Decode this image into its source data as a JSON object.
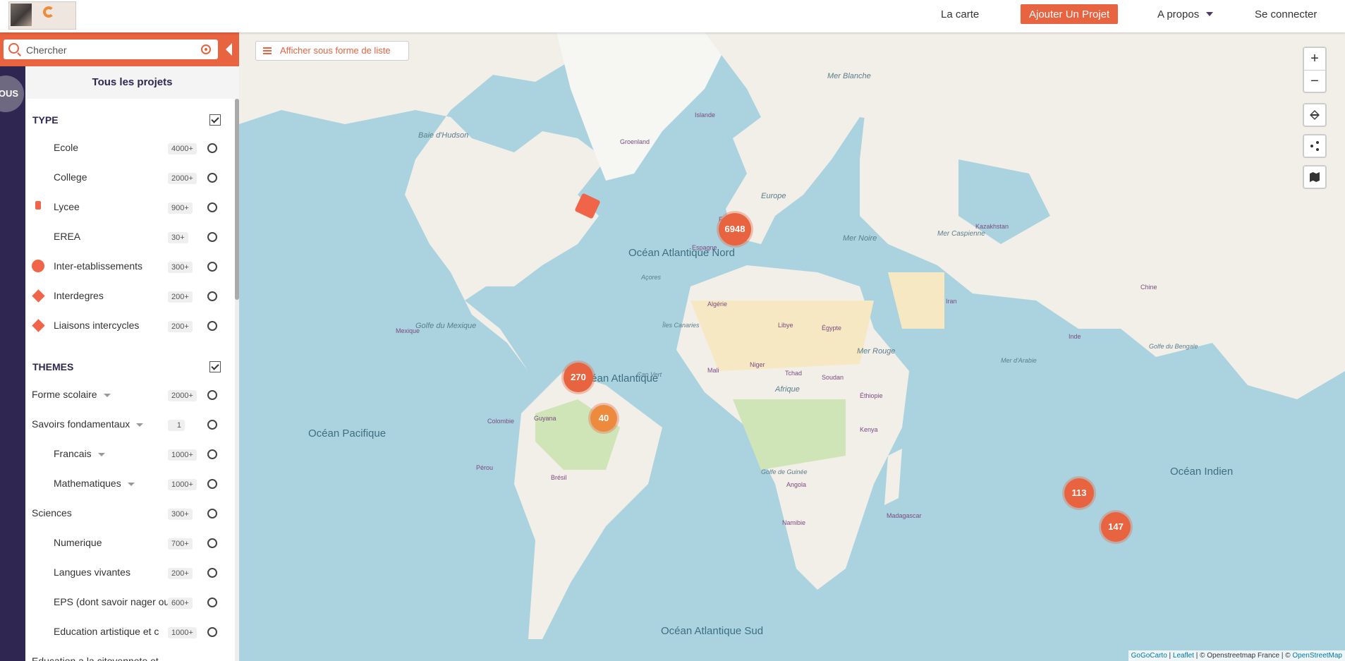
{
  "header": {
    "nav_carte": "La carte",
    "nav_add_project": "Ajouter Un Projet",
    "nav_about": "A propos",
    "nav_login": "Se connecter"
  },
  "sidebar": {
    "tous_label": "OUS",
    "search_placeholder": "Chercher",
    "panel_title": "Tous les projets",
    "type_section": "TYPE",
    "themes_section": "THEMES",
    "type_items": [
      {
        "label": "Ecole",
        "count": "4000+",
        "color": "#f0654a",
        "icon": "pin-icon"
      },
      {
        "label": "College",
        "count": "2000+",
        "color": "#f0654a",
        "icon": "pin-small-icon"
      },
      {
        "label": "Lycee",
        "count": "900+",
        "color": "#f0654a",
        "icon": "pushpin-icon"
      },
      {
        "label": "EREA",
        "count": "30+",
        "color": "#f0654a",
        "icon": "pin-icon"
      },
      {
        "label": "Inter-etablissements",
        "count": "300+",
        "color": "#f0654a",
        "icon": "circle-icon"
      },
      {
        "label": "Interdegres",
        "count": "200+",
        "color": "#f0654a",
        "icon": "diamond-icon"
      },
      {
        "label": "Liaisons intercycles",
        "count": "200+",
        "color": "#f0654a",
        "icon": "diamond-icon"
      }
    ],
    "theme_items": [
      {
        "label": "Forme scolaire",
        "count": "2000+",
        "color": "",
        "expandable": true
      },
      {
        "label": "Savoirs fondamentaux",
        "count": "1",
        "color": "",
        "expandable": true
      },
      {
        "label": "Francais",
        "count": "1000+",
        "color": "#1b4f9c",
        "expandable": true
      },
      {
        "label": "Mathematiques",
        "count": "1000+",
        "color": "#2f7d2b",
        "expandable": true
      },
      {
        "label": "Sciences",
        "count": "300+",
        "color": "",
        "expandable": false
      },
      {
        "label": "Numerique",
        "count": "700+",
        "color": "#f2c230",
        "expandable": false
      },
      {
        "label": "Langues vivantes",
        "count": "200+",
        "color": "#c0620e",
        "expandable": false
      },
      {
        "label": "EPS (dont savoir nager ou",
        "count": "600+",
        "color": "#d81a8a",
        "expandable": false
      },
      {
        "label": "Education artistique et c",
        "count": "1000+",
        "color": "#9a7fd0",
        "expandable": false
      },
      {
        "label": "Education a la citoyennete et",
        "count": "",
        "color": "",
        "expandable": false
      }
    ]
  },
  "map": {
    "list_button": "Afficher sous forme de liste",
    "zoom_in": "+",
    "zoom_out": "−",
    "clusters": [
      {
        "count": "6948",
        "color": "#e8633f"
      },
      {
        "count": "270",
        "color": "#e8633f"
      },
      {
        "count": "40",
        "color": "#ee8a3e"
      },
      {
        "count": "113",
        "color": "#e8633f"
      },
      {
        "count": "147",
        "color": "#e8633f"
      }
    ],
    "oceans": {
      "atl_nord": "Océan Atlantique Nord",
      "atl": "Océan Atlantique",
      "atl_sud": "Océan Atlantique Sud",
      "pacifique": "Océan Pacifique",
      "indien": "Océan Indien"
    },
    "labels": {
      "europe": "Europe",
      "afrique": "Afrique",
      "mer_noire": "Mer Noire",
      "mer_rouge": "Mer Rouge",
      "golfe_mexique": "Golfe du Mexique",
      "baie_hudson": "Baie d'Hudson",
      "mer_blanche": "Mer Blanche",
      "mer_caspienne": "Mer Caspienne",
      "iles_canaries": "Îles Canaries",
      "cap_vert": "Cap Vert",
      "madagascar": "Madagascar",
      "bresil": "Brésil",
      "mexique": "Mexique",
      "colombie": "Colombie",
      "perou": "Pérou",
      "egypte": "Égypte",
      "libye": "Libye",
      "algerie": "Algérie",
      "mali": "Mali",
      "niger": "Niger",
      "tchad": "Tchad",
      "soudan": "Soudan",
      "ethiopie": "Éthiopie",
      "kenya": "Kenya",
      "angola": "Angola",
      "namibie": "Namibie",
      "iran": "Iran",
      "inde": "Inde",
      "chine": "Chine",
      "kazakhstan": "Kazakhstan",
      "france": "France",
      "espagne": "Espagne",
      "islande": "Islande",
      "groenland": "Groenland",
      "acores": "Açores",
      "guyana": "Guyana",
      "golfe_guinee": "Golfe de Guinée",
      "mer_arabie": "Mer d'Arabie",
      "golfe_bengale": "Golfe du Bengale"
    },
    "attribution": {
      "gogocarto": "GoGoCarto",
      "leaflet": "Leaflet",
      "osm_text": "| © Openstreetmap France | ©",
      "osm": "OpenStreetMap"
    }
  }
}
